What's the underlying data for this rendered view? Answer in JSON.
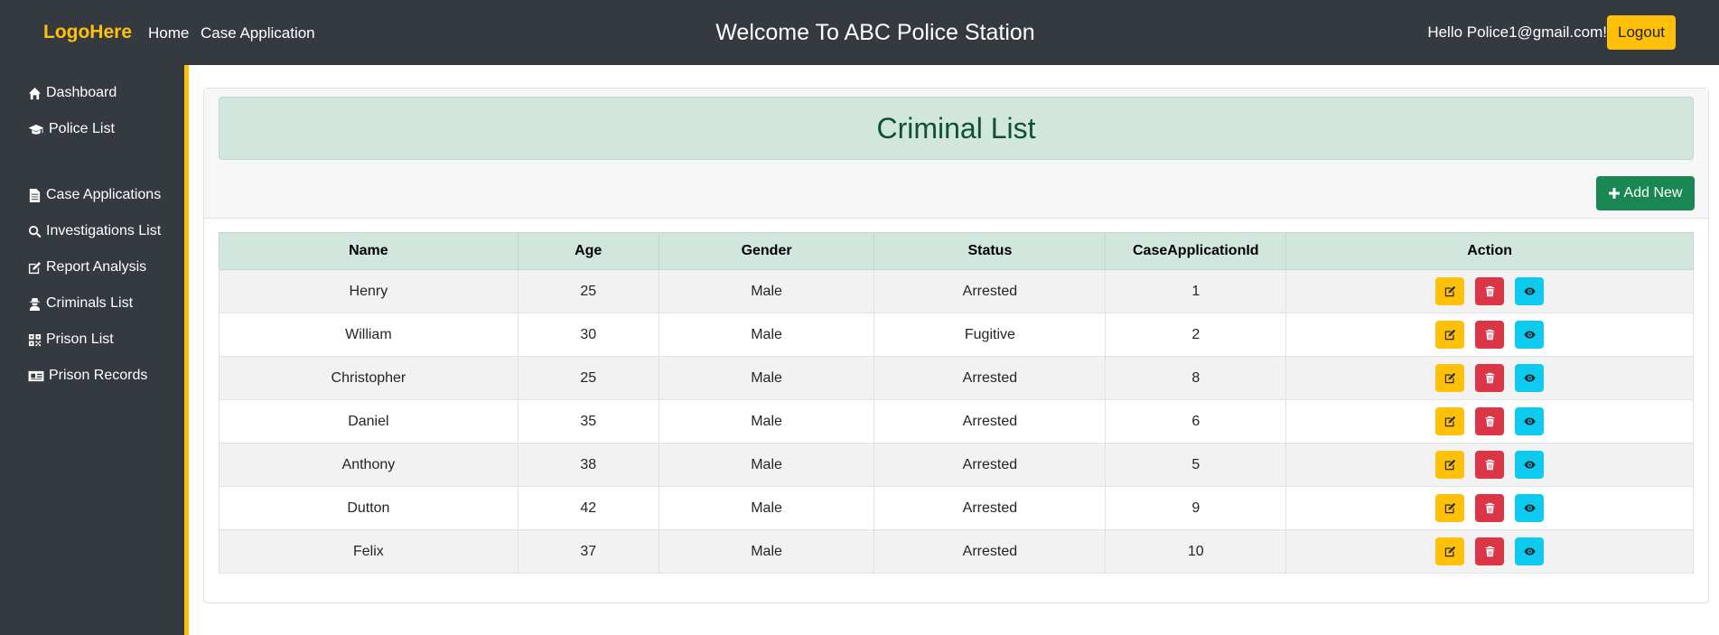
{
  "header": {
    "logo": "LogoHere",
    "nav": [
      "Home",
      "Case Application"
    ],
    "title": "Welcome To ABC Police Station",
    "greeting": "Hello Police1@gmail.com!",
    "logout_label": "Logout"
  },
  "sidebar": {
    "items": [
      {
        "label": "Dashboard",
        "icon": "home-icon"
      },
      {
        "label": "Police List",
        "icon": "graduation-cap-icon"
      },
      {
        "label": "Case Applications",
        "icon": "file-icon"
      },
      {
        "label": "Investigations List",
        "icon": "search-icon"
      },
      {
        "label": "Report Analysis",
        "icon": "edit-icon"
      },
      {
        "label": "Criminals List",
        "icon": "user-secret-icon"
      },
      {
        "label": "Prison List",
        "icon": "qrcode-icon"
      },
      {
        "label": "Prison Records",
        "icon": "id-card-icon"
      }
    ]
  },
  "main": {
    "page_title": "Criminal List",
    "add_label": "Add New",
    "table": {
      "columns": [
        "Name",
        "Age",
        "Gender",
        "Status",
        "CaseApplicationId",
        "Action"
      ],
      "rows": [
        [
          "Henry",
          "25",
          "Male",
          "Arrested",
          "1"
        ],
        [
          "William",
          "30",
          "Male",
          "Fugitive",
          "2"
        ],
        [
          "Christopher",
          "25",
          "Male",
          "Arrested",
          "8"
        ],
        [
          "Daniel",
          "35",
          "Male",
          "Arrested",
          "6"
        ],
        [
          "Anthony",
          "38",
          "Male",
          "Arrested",
          "5"
        ],
        [
          "Dutton",
          "42",
          "Male",
          "Arrested",
          "9"
        ],
        [
          "Felix",
          "37",
          "Male",
          "Arrested",
          "10"
        ]
      ]
    }
  },
  "colors": {
    "navbar": "#343a40",
    "accent": "#ffc107",
    "title_bg": "#d1e7dd",
    "title_text": "#0f5132",
    "add_button": "#198754",
    "edit_button": "#ffc107",
    "delete_button": "#dc3545",
    "view_button": "#0dcaf0"
  }
}
